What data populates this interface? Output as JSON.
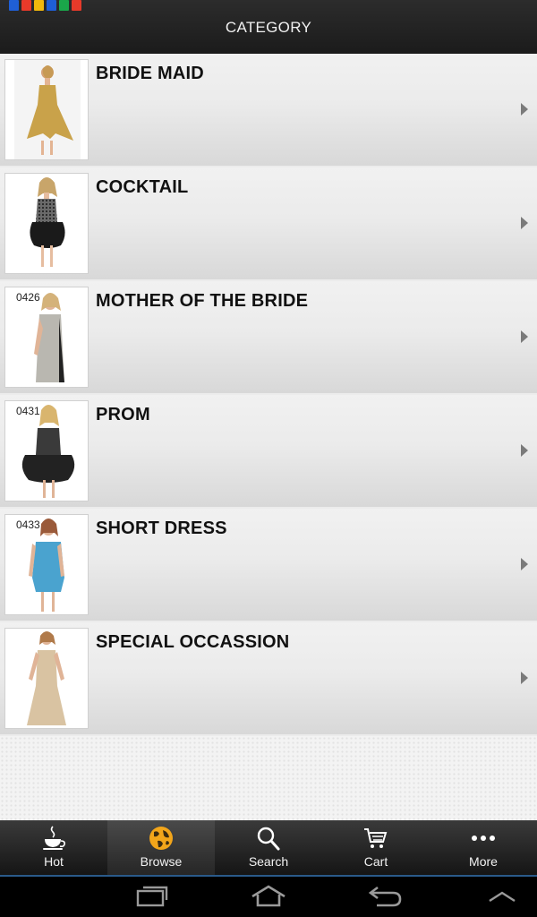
{
  "header": {
    "title": "CATEGORY"
  },
  "status_colors": [
    "#1f5fd6",
    "#e83a2a",
    "#f2b90c",
    "#1f5fd6",
    "#1aa64a",
    "#e83a2a"
  ],
  "categories": [
    {
      "label": "BRIDE MAID",
      "code": "",
      "dress_color": "#c9a24a"
    },
    {
      "label": "COCKTAIL",
      "code": "",
      "dress_color": "#1a1a1a"
    },
    {
      "label": "MOTHER OF THE BRIDE",
      "code": "0426",
      "dress_color": "#b9b7b0"
    },
    {
      "label": "PROM",
      "code": "0431",
      "dress_color": "#222222"
    },
    {
      "label": "SHORT DRESS",
      "code": "0433",
      "dress_color": "#4aa3cf"
    },
    {
      "label": "SPECIAL OCCASSION",
      "code": "",
      "dress_color": "#d9c3a2"
    }
  ],
  "tabbar": {
    "tabs": [
      {
        "label": "Hot",
        "icon": "coffee-cup-icon"
      },
      {
        "label": "Browse",
        "icon": "globe-icon",
        "active": true
      },
      {
        "label": "Search",
        "icon": "search-icon"
      },
      {
        "label": "Cart",
        "icon": "cart-icon"
      },
      {
        "label": "More",
        "icon": "more-dots-icon"
      }
    ]
  },
  "system_nav": [
    "recent-apps-icon",
    "home-icon",
    "back-icon",
    "up-chevron-icon"
  ]
}
